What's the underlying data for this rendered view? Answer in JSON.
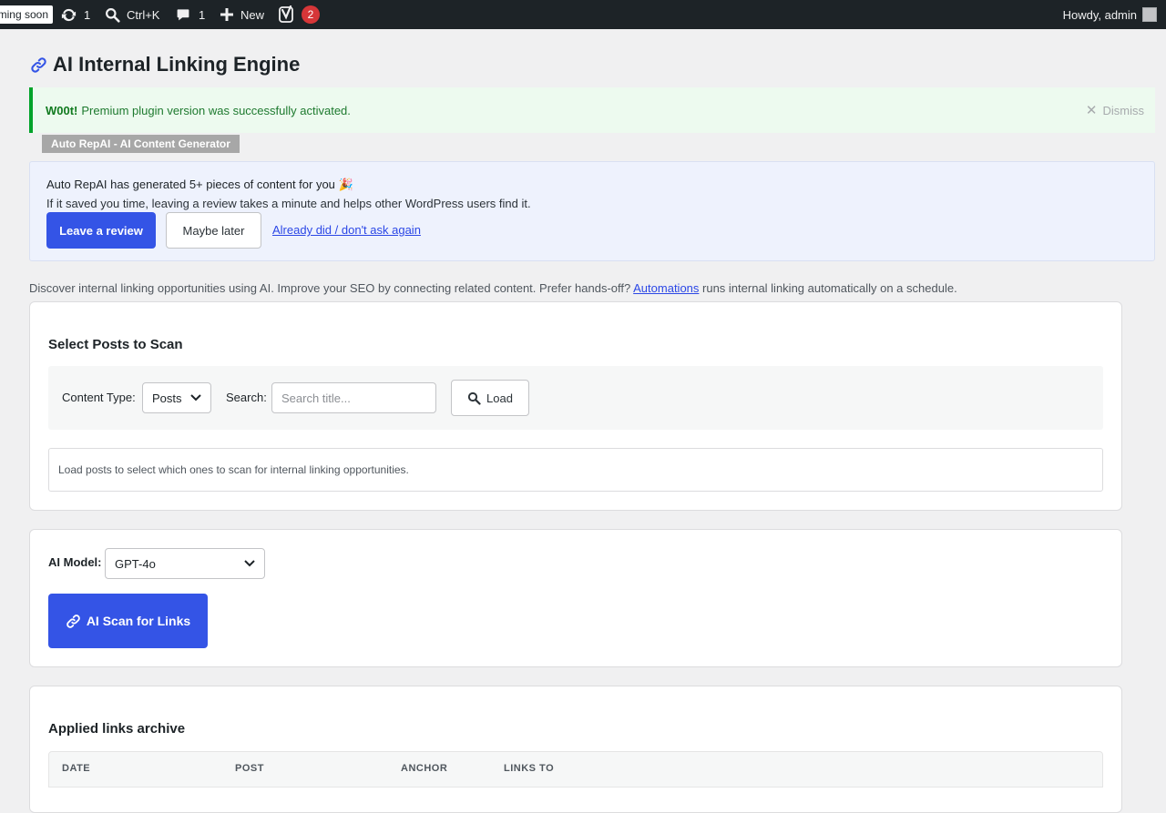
{
  "adminbar": {
    "coming_soon": "Coming soon",
    "updates_count": "1",
    "search_shortcut": "Ctrl+K",
    "comments_count": "1",
    "new_label": "New",
    "yoast_count": "2",
    "howdy": "Howdy, admin"
  },
  "page": {
    "title": "AI Internal Linking Engine"
  },
  "notice": {
    "bold": "W00t!",
    "message": "Premium plugin version was successfully activated.",
    "dismiss": "Dismiss"
  },
  "plugin_tag": "Auto RepAI - AI Content Generator",
  "review": {
    "title": "Auto RepAI has generated 5+ pieces of content for you 🎉",
    "subtitle": "If it saved you time, leaving a review takes a minute and helps other WordPress users find it.",
    "leave_review": "Leave a review",
    "maybe_later": "Maybe later",
    "dont_ask": "Already did / don't ask again"
  },
  "intro": {
    "text_before": "Discover internal linking opportunities using AI. Improve your SEO by connecting related content. Prefer hands-off? ",
    "link": "Automations",
    "text_after": " runs internal linking automatically on a schedule."
  },
  "select_posts": {
    "title": "Select Posts to Scan",
    "content_type_label": "Content Type:",
    "content_type_value": "Posts",
    "search_label": "Search:",
    "search_placeholder": "Search title...",
    "load_button": "Load",
    "empty_message": "Load posts to select which ones to scan for internal linking opportunities."
  },
  "scan": {
    "model_label": "AI Model:",
    "model_value": "GPT-4o",
    "scan_button": "AI Scan for Links"
  },
  "archive": {
    "title": "Applied links archive",
    "columns": [
      "DATE",
      "POST",
      "ANCHOR",
      "LINKS TO"
    ]
  },
  "colors": {
    "primary": "#3454e6",
    "success": "#00a32a",
    "adminbar": "#1d2327",
    "badge": "#d63638"
  }
}
